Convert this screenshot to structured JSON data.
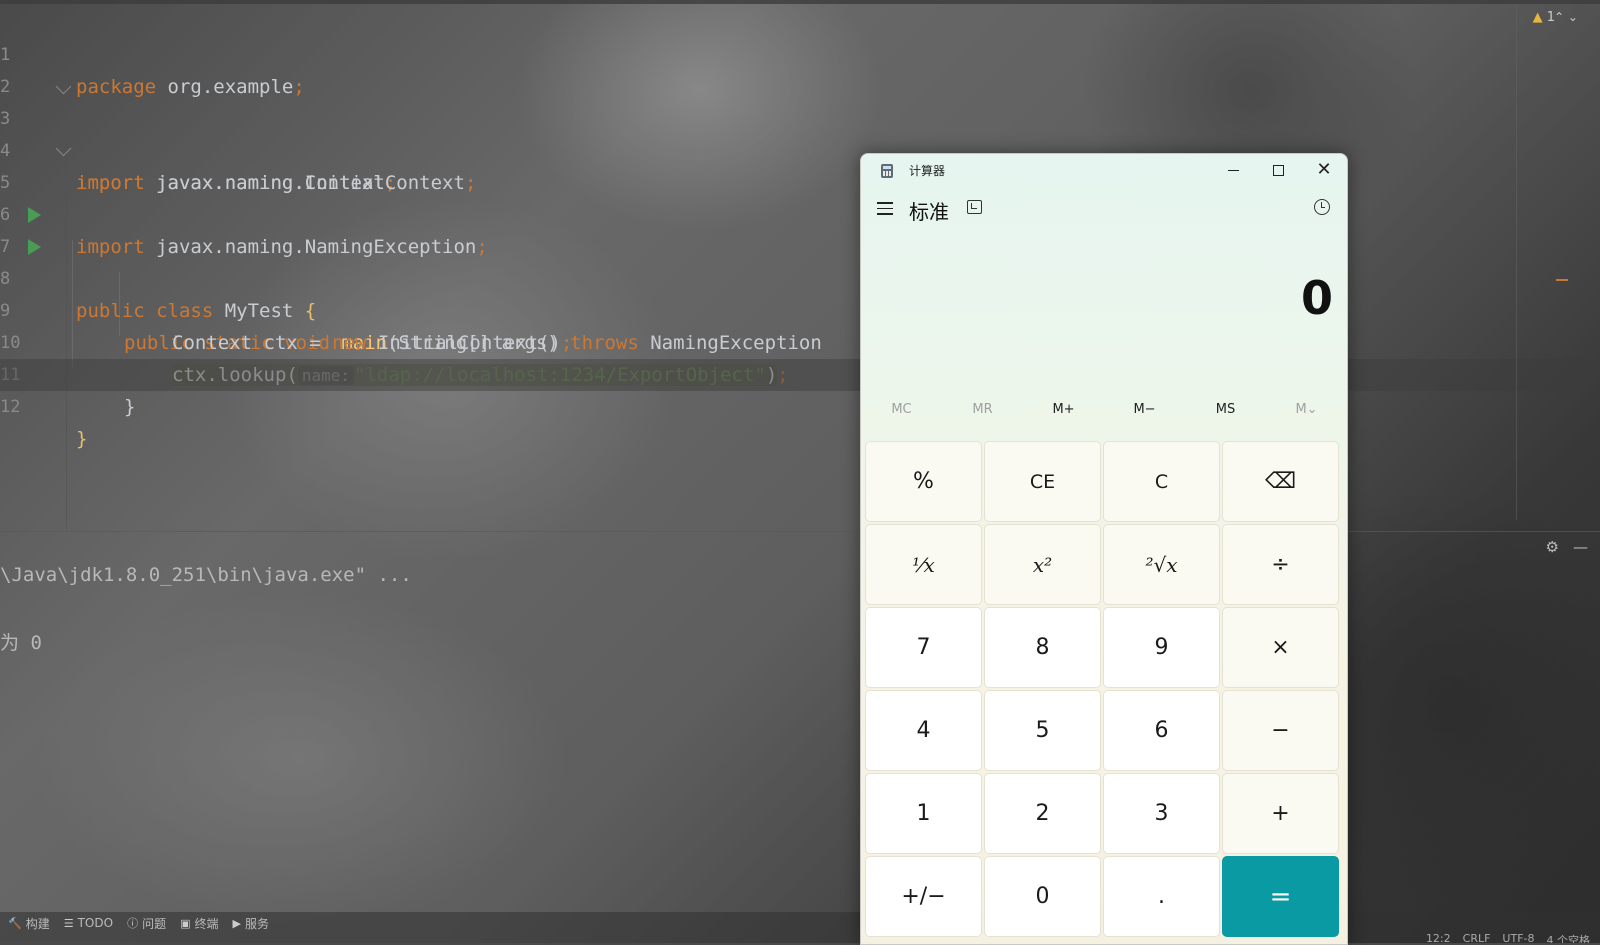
{
  "editor": {
    "lines": [
      {
        "n": "1"
      },
      {
        "n": "2"
      },
      {
        "n": "3"
      },
      {
        "n": "4"
      },
      {
        "n": "5"
      },
      {
        "n": "6"
      },
      {
        "n": "7"
      },
      {
        "n": "8"
      },
      {
        "n": "9"
      },
      {
        "n": "10"
      },
      {
        "n": "11"
      },
      {
        "n": "12"
      }
    ],
    "code": {
      "l1_kw": "package",
      "l1_rest": " org.example",
      "l3_kw": "import",
      "l3_rest": " javax.naming.Context",
      "l4_kw": "import",
      "l4_rest": " javax.naming.InitialContext",
      "l5_kw": "import",
      "l5_rest": " javax.naming.NamingException",
      "l7_kw": "public class",
      "l7_name": " MyTest ",
      "l7_brace": "{",
      "l8_kw": "public static void",
      "l8_fn": " main",
      "l8_args": "(String[] args) ",
      "l8_throws": "throws",
      "l8_exc": " NamingException",
      "l9_a": "Context ctx = ",
      "l9_kw": "new",
      "l9_b": " InitialContext()",
      "l10_a": "ctx.lookup(",
      "l10_hint": "name:",
      "l10_str": "\"ldap://localhost:1234/ExportObject\"",
      "l10_b": ")",
      "l11": "}",
      "l12": "}",
      "semicolon": ";"
    },
    "warning_count": "1",
    "nav_arrows": "⌃ ⌄"
  },
  "console": {
    "line1": "\\Java\\jdk1.8.0_251\\bin\\java.exe\" ...",
    "line2": "为 0"
  },
  "tool_tabs": [
    {
      "label": "构建",
      "icon": "build-icon"
    },
    {
      "label": "TODO",
      "icon": "todo-icon"
    },
    {
      "label": "问题",
      "icon": "problems-icon"
    },
    {
      "label": "终端",
      "icon": "terminal-icon"
    },
    {
      "label": "服务",
      "icon": "services-icon"
    }
  ],
  "status": {
    "position": "12:2",
    "line_sep": "CRLF",
    "encoding": "UTF-8",
    "indent": "4 个空格"
  },
  "calculator": {
    "window_title": "计算器",
    "mode": "标准",
    "display": "0",
    "memory": [
      "MC",
      "MR",
      "M+",
      "M−",
      "MS",
      "M⌄"
    ],
    "keys": [
      "%",
      "CE",
      "C",
      "⌫",
      "⅟x",
      "x²",
      "²√x",
      "÷",
      "7",
      "8",
      "9",
      "×",
      "4",
      "5",
      "6",
      "−",
      "1",
      "2",
      "3",
      "+",
      "+/−",
      "0",
      ".",
      "="
    ],
    "accent_color": "#0a9aa4"
  },
  "colors": {
    "keyword": "#cc7832",
    "string": "#6a8759",
    "function": "#ffc66d",
    "run_icon": "#499c54"
  }
}
